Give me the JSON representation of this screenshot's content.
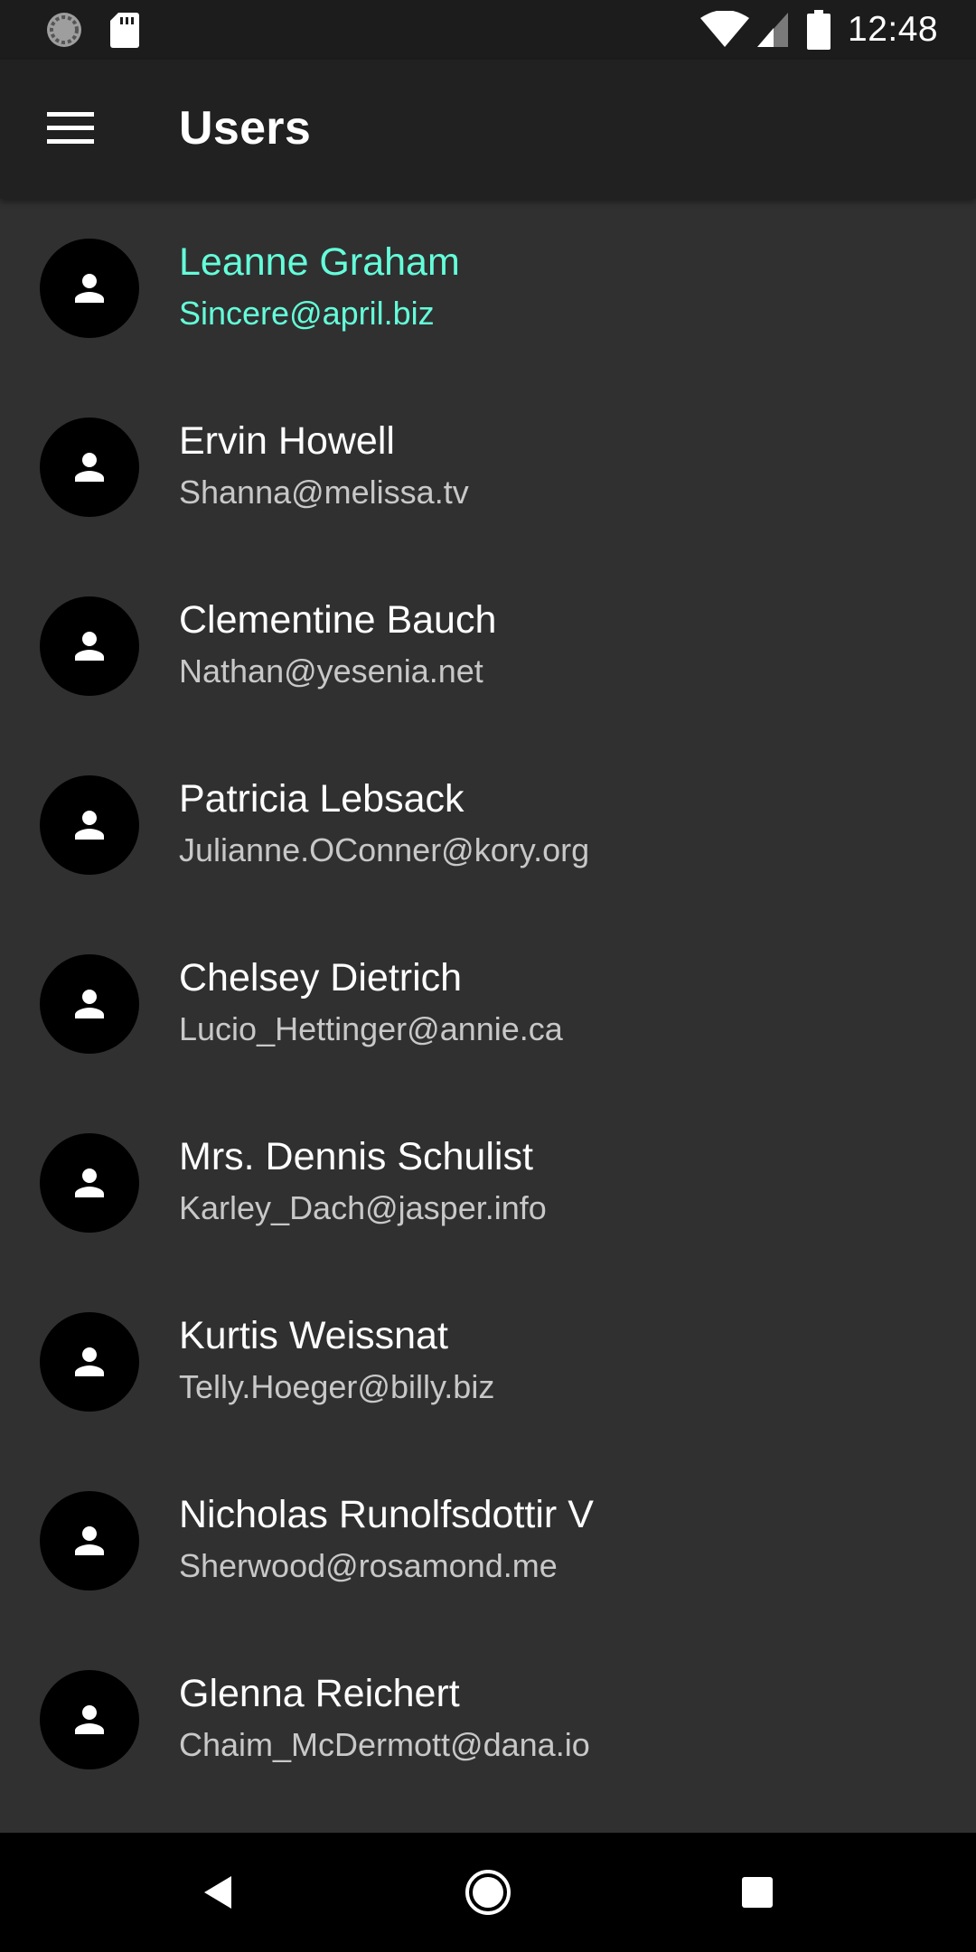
{
  "status_bar": {
    "time": "12:48",
    "icons": [
      "loading-icon",
      "sd-card-icon",
      "wifi-icon",
      "cell-signal-icon",
      "battery-icon"
    ]
  },
  "app_bar": {
    "title": "Users",
    "menu_icon": "menu-icon"
  },
  "users": [
    {
      "name": "Leanne Graham",
      "email": "Sincere@april.biz",
      "selected": true
    },
    {
      "name": "Ervin Howell",
      "email": "Shanna@melissa.tv",
      "selected": false
    },
    {
      "name": "Clementine Bauch",
      "email": "Nathan@yesenia.net",
      "selected": false
    },
    {
      "name": "Patricia Lebsack",
      "email": "Julianne.OConner@kory.org",
      "selected": false
    },
    {
      "name": "Chelsey Dietrich",
      "email": "Lucio_Hettinger@annie.ca",
      "selected": false
    },
    {
      "name": "Mrs. Dennis Schulist",
      "email": "Karley_Dach@jasper.info",
      "selected": false
    },
    {
      "name": "Kurtis Weissnat",
      "email": "Telly.Hoeger@billy.biz",
      "selected": false
    },
    {
      "name": "Nicholas Runolfsdottir V",
      "email": "Sherwood@rosamond.me",
      "selected": false
    },
    {
      "name": "Glenna Reichert",
      "email": "Chaim_McDermott@dana.io",
      "selected": false
    }
  ],
  "nav_bar": {
    "icons": [
      "back-icon",
      "home-icon",
      "recents-icon"
    ]
  },
  "colors": {
    "background": "#303030",
    "app_bar": "#212121",
    "status_bar": "#1c1c1c",
    "accent": "#64ffda",
    "avatar": "#000000"
  }
}
